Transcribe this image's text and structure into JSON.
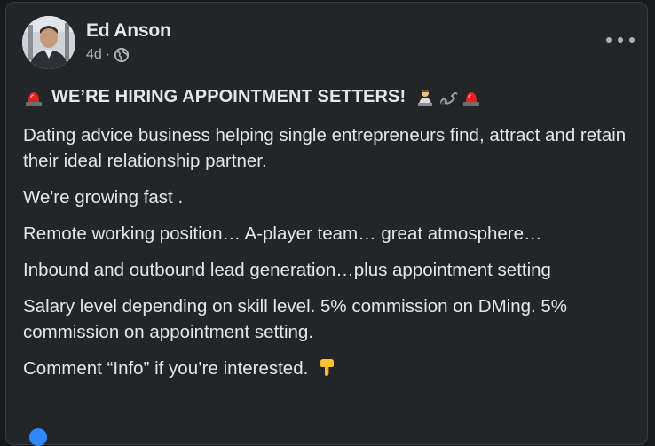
{
  "post": {
    "author": "Ed Anson",
    "time": "4d",
    "separator": "·",
    "headline": "WE’RE HIRING APPOINTMENT SETTERS!",
    "paragraphs": [
      "Dating advice business helping single entrepreneurs find, attract and retain their ideal relationship partner.",
      "We're growing fast .",
      "Remote working position… A-player team… great atmosphere…",
      "Inbound and outbound lead generation…plus appointment setting",
      "Salary level depending on skill level. 5% commission on DMing. 5% commission on appointment setting.",
      "Comment “Info” if you’re interested."
    ]
  },
  "icons": {
    "globe": "globe-icon",
    "more": "more-options-icon",
    "siren": "siren-icon",
    "office_worker": "office-worker-icon",
    "phone": "phone-icon",
    "point_down": "pointing-down-icon"
  },
  "colors": {
    "background": "#18191a",
    "card": "#242526",
    "text_primary": "#e4e6eb",
    "text_secondary": "#b0b3b8"
  }
}
